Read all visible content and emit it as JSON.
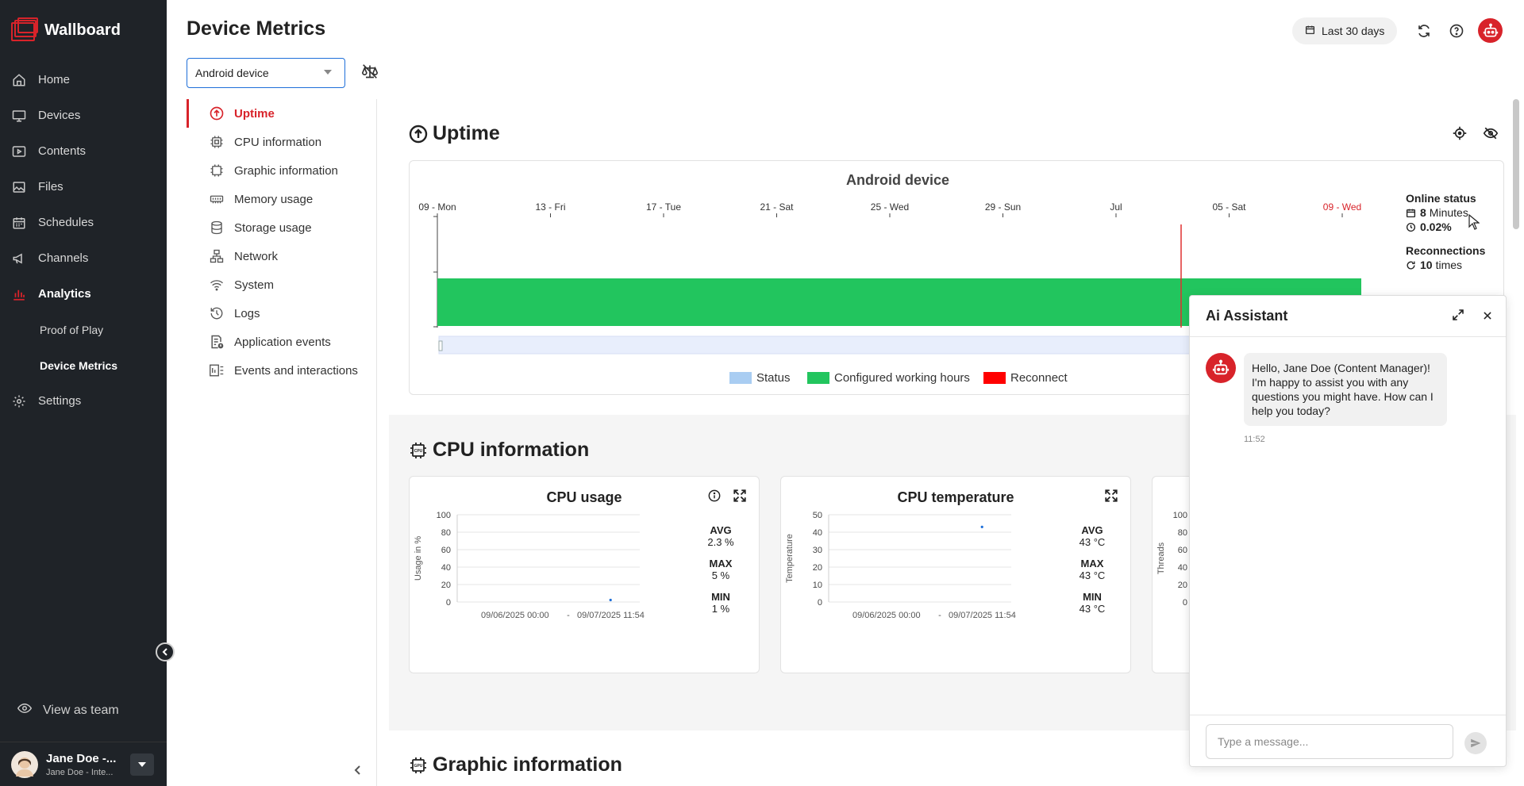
{
  "brand": {
    "name": "Wallboard"
  },
  "sidebar": {
    "items": [
      {
        "label": "Home",
        "icon": "home-icon"
      },
      {
        "label": "Devices",
        "icon": "monitor-icon"
      },
      {
        "label": "Contents",
        "icon": "play-icon"
      },
      {
        "label": "Files",
        "icon": "image-icon"
      },
      {
        "label": "Schedules",
        "icon": "calendar-icon"
      },
      {
        "label": "Channels",
        "icon": "megaphone-icon"
      },
      {
        "label": "Analytics",
        "icon": "bar-chart-icon"
      }
    ],
    "sub_items": [
      {
        "label": "Proof of Play"
      },
      {
        "label": "Device Metrics"
      }
    ],
    "settings_label": "Settings",
    "view_as_team": "View as team",
    "user": {
      "name": "Jane Doe -...",
      "role": "Jane Doe - Inte..."
    }
  },
  "header": {
    "title": "Device Metrics",
    "date_range": "Last 30 days",
    "device_select": "Android device"
  },
  "sections": [
    {
      "label": "Uptime",
      "icon": "arrow-up-circle-icon"
    },
    {
      "label": "CPU information",
      "icon": "cpu-icon"
    },
    {
      "label": "Graphic information",
      "icon": "gpu-icon"
    },
    {
      "label": "Memory usage",
      "icon": "memory-icon"
    },
    {
      "label": "Storage usage",
      "icon": "database-icon"
    },
    {
      "label": "Network",
      "icon": "network-icon"
    },
    {
      "label": "System",
      "icon": "wifi-icon"
    },
    {
      "label": "Logs",
      "icon": "history-icon"
    },
    {
      "label": "Application events",
      "icon": "app-events-icon"
    },
    {
      "label": "Events and interactions",
      "icon": "events-icon"
    }
  ],
  "uptime": {
    "title": "Uptime",
    "device": "Android device",
    "timeline_labels": [
      "09 - Mon",
      "13 - Fri",
      "17 - Tue",
      "21 - Sat",
      "25 - Wed",
      "29 - Sun",
      "Jul",
      "05 - Sat",
      "09 - Wed"
    ],
    "online_status_label": "Online status",
    "online_minutes_value": "8",
    "online_minutes_unit": "Minutes",
    "online_percent": "0.02%",
    "reconnections_label": "Reconnections",
    "reconnections_value": "10",
    "reconnections_unit": "times",
    "legend": [
      "Status",
      "Configured working hours",
      "Reconnect"
    ],
    "colors": {
      "status": "#a9cdf2",
      "working": "#22c55e",
      "reconnect": "#ff0000",
      "brand": "#d8232a"
    }
  },
  "cpu": {
    "title": "CPU information",
    "usage": {
      "title": "CPU usage",
      "ylabel": "Usage in %",
      "yticks": [
        "100",
        "80",
        "60",
        "40",
        "20",
        "0"
      ],
      "x_start": "09/06/2025 00:00",
      "x_sep": "-",
      "x_end": "09/07/2025 11:54",
      "avg_label": "AVG",
      "avg": "2.3 %",
      "max_label": "MAX",
      "max": "5 %",
      "min_label": "MIN",
      "min": "1 %"
    },
    "temperature": {
      "title": "CPU temperature",
      "ylabel": "Temperature",
      "yticks": [
        "50",
        "40",
        "30",
        "20",
        "10",
        "0"
      ],
      "x_start": "09/06/2025 00:00",
      "x_sep": "-",
      "x_end": "09/07/2025 11:54",
      "avg_label": "AVG",
      "avg": "43 °C",
      "max_label": "MAX",
      "max": "43 °C",
      "min_label": "MIN",
      "min": "43 °C"
    },
    "threads": {
      "ylabel": "Threads",
      "yticks": [
        "100",
        "80",
        "60",
        "40",
        "20",
        "0"
      ]
    }
  },
  "graphic": {
    "title": "Graphic information"
  },
  "ai": {
    "title": "Ai Assistant",
    "message": "Hello, Jane Doe (Content Manager)! I'm happy to assist you with any questions you might have. How can I help you today?",
    "time": "11:52",
    "placeholder": "Type a message..."
  }
}
